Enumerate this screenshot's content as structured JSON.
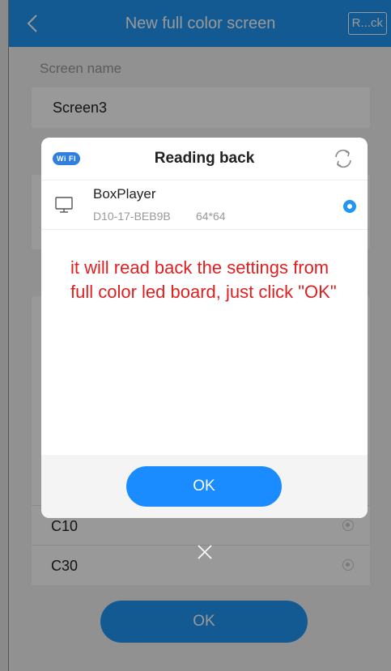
{
  "header": {
    "title": "New full color screen",
    "readback_label": "R...ck"
  },
  "form": {
    "screen_name_label": "Screen name",
    "screen_name_value": "Screen3",
    "rows": [
      {
        "label": "C10"
      },
      {
        "label": "C30"
      }
    ],
    "ok_label": "OK"
  },
  "dialog": {
    "wifi_badge": "Wi FI",
    "title": "Reading back",
    "device": {
      "name": "BoxPlayer",
      "id": "D10-17-BEB9B",
      "size": "64*64"
    },
    "annotation": "it will read back the settings from full color led board, just click \"OK\"",
    "ok_label": "OK"
  },
  "colors": {
    "accent": "#2196f3",
    "annotation": "#e02020"
  }
}
